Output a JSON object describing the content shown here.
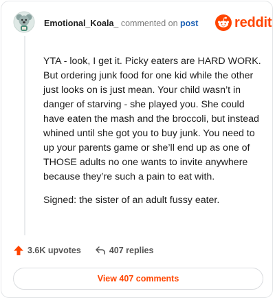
{
  "header": {
    "username": "Emotional_Koala_",
    "commented_text": "commented on",
    "post_link": "post",
    "logo_word": "reddit"
  },
  "comment": {
    "paragraphs": [
      "YTA - look, I get it. Picky eaters are HARD WORK. But ordering junk food for one kid while the other just looks on is just mean. Your child wasn’t in danger of starving - she played you. She could have eaten the mash and the broccoli, but instead whined until she got you to buy junk. You need to up your parents game or she’ll end up as one of THOSE adults no one wants to invite anywhere because they’re such a pain to eat with.",
      "Signed: the sister of an adult fussy eater."
    ]
  },
  "footer": {
    "upvotes": "3.6K upvotes",
    "replies": "407 replies",
    "view_button": "View 407 comments"
  },
  "colors": {
    "accent": "#ff4500",
    "link": "#1a5fb4"
  },
  "icons": {
    "avatar": "koala-avatar-icon",
    "logo": "reddit-alien-icon",
    "upvote": "upvote-arrow-icon",
    "reply": "reply-arrow-icon"
  }
}
